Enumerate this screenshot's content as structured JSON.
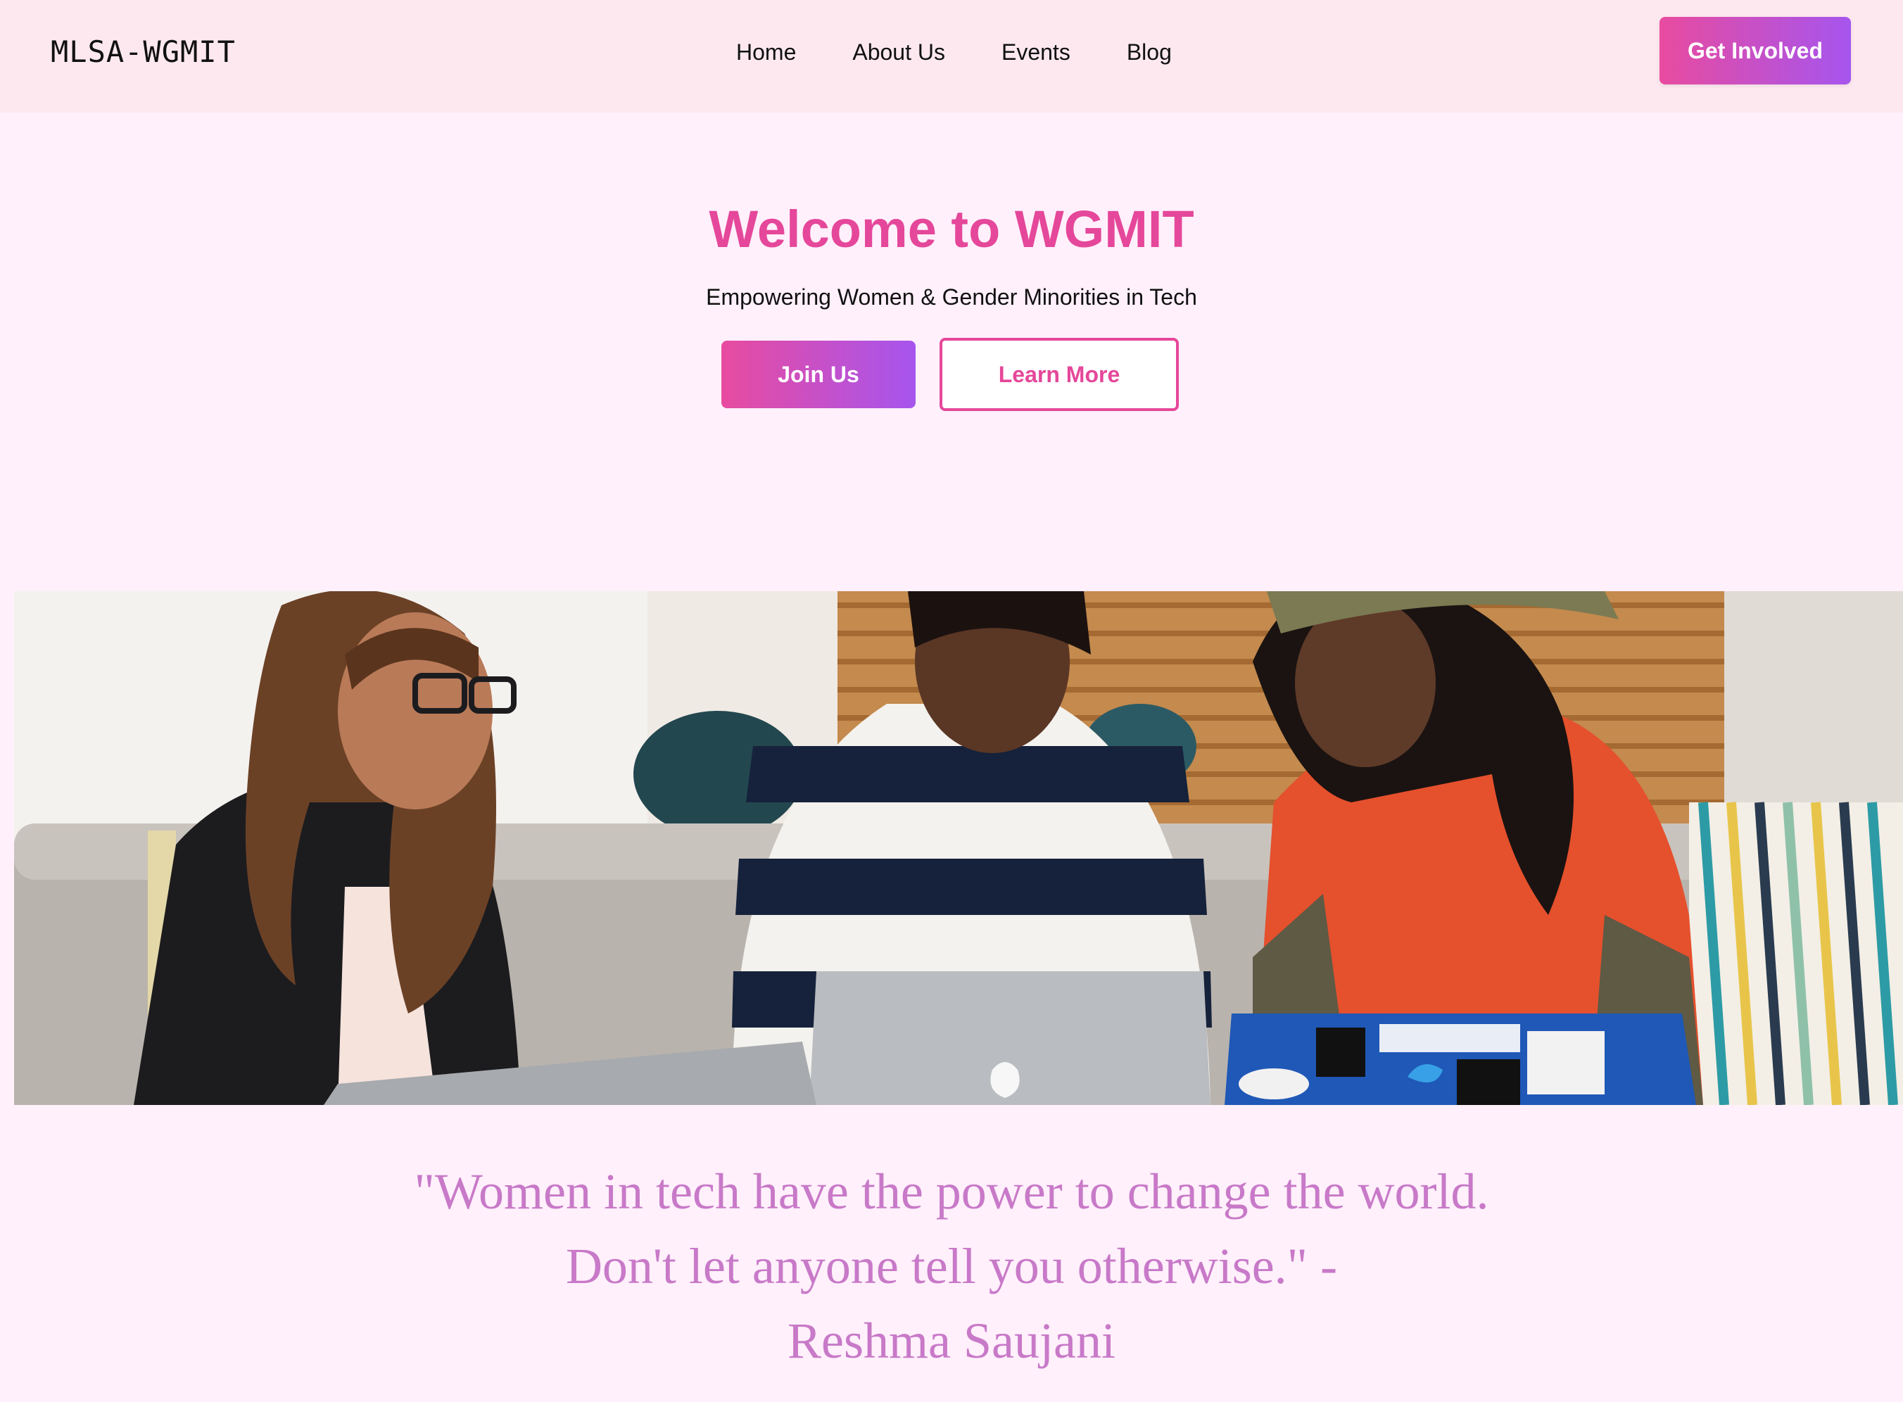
{
  "navbar": {
    "logo": "MLSA-WGMIT",
    "links": [
      "Home",
      "About Us",
      "Events",
      "Blog"
    ],
    "cta_label": "Get Involved"
  },
  "hero": {
    "title": "Welcome to WGMIT",
    "subtitle": "Empowering Women & Gender Minorities in Tech",
    "primary_button": "Join Us",
    "secondary_button": "Learn More"
  },
  "quote": {
    "line1": "\"Women in tech have the power to change the world.",
    "line2": "Don't let anyone tell you otherwise.\" -",
    "line3": "Reshma Saujani"
  },
  "colors": {
    "accent": "#e5479a",
    "gradient_start": "#e84b9f",
    "gradient_end": "#a655ee",
    "nav_background": "#fde8f0",
    "page_background": "#fff0fb",
    "quote_text": "#c879c8"
  }
}
